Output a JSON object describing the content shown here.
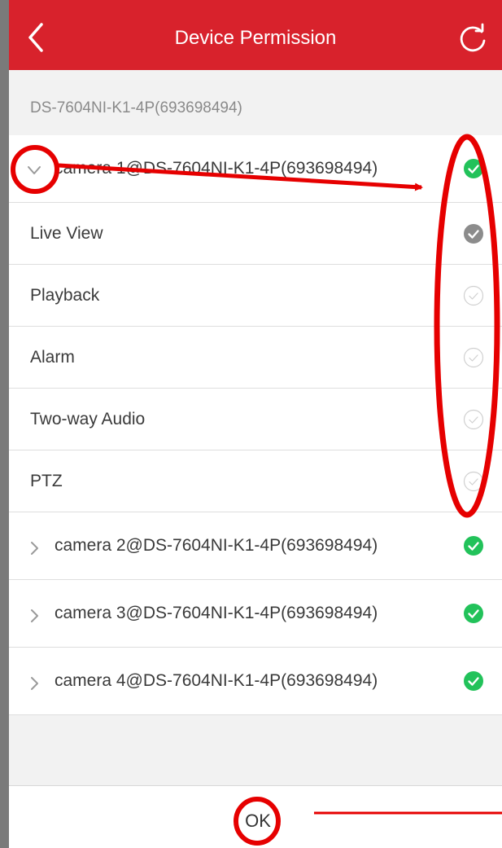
{
  "header": {
    "title": "Device Permission",
    "back_icon": "back-arrow-icon",
    "refresh_icon": "refresh-icon"
  },
  "device": {
    "label": "DS-7604NI-K1-4P(693698494)"
  },
  "cameras": [
    {
      "label": "camera 1@DS-7604NI-K1-4P(693698494)",
      "expanded": true,
      "checked": true,
      "permissions": [
        {
          "label": "Live View",
          "state": "checked-gray"
        },
        {
          "label": "Playback",
          "state": "unchecked"
        },
        {
          "label": "Alarm",
          "state": "unchecked"
        },
        {
          "label": "Two-way Audio",
          "state": "unchecked"
        },
        {
          "label": "PTZ",
          "state": "unchecked"
        }
      ]
    },
    {
      "label": "camera 2@DS-7604NI-K1-4P(693698494)",
      "expanded": false,
      "checked": true
    },
    {
      "label": "camera 3@DS-7604NI-K1-4P(693698494)",
      "expanded": false,
      "checked": true
    },
    {
      "label": "camera 4@DS-7604NI-K1-4P(693698494)",
      "expanded": false,
      "checked": true
    }
  ],
  "footer": {
    "ok_label": "OK"
  },
  "colors": {
    "header": "#d8222c",
    "check_green": "#22c25a",
    "check_gray": "#8c8c8c",
    "annotation_red": "#e60000"
  }
}
